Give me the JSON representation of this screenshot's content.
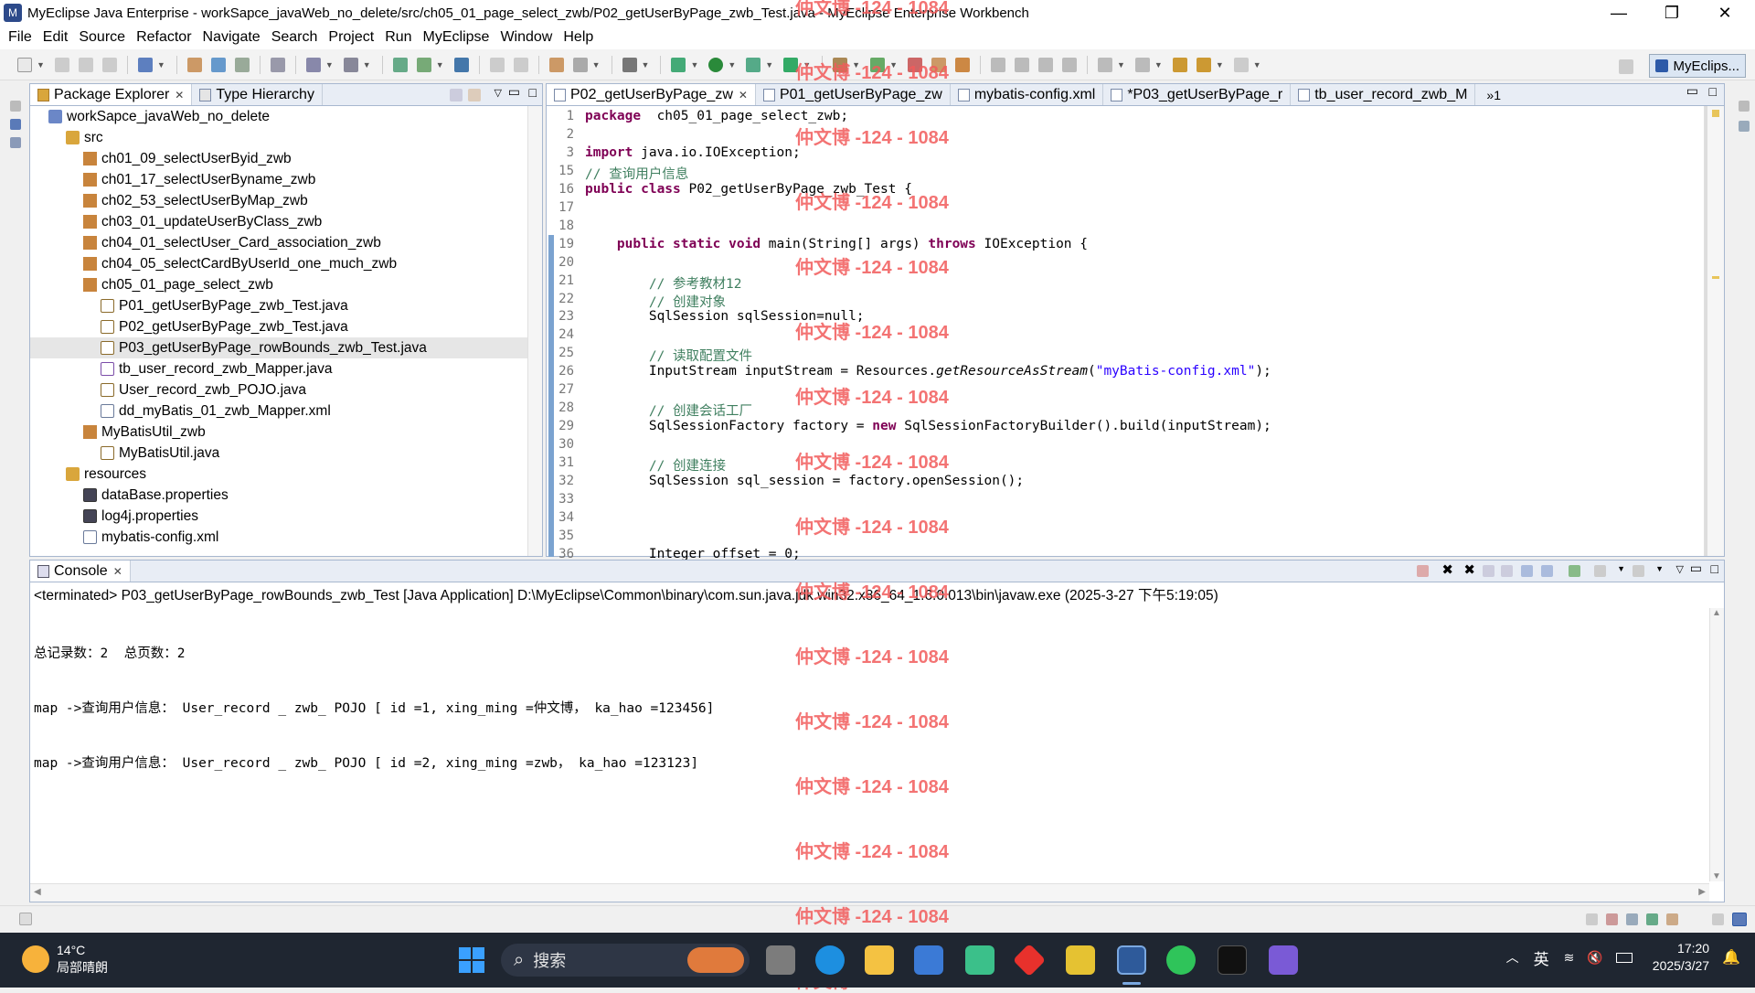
{
  "window": {
    "title": "MyEclipse Java Enterprise - workSapce_javaWeb_no_delete/src/ch05_01_page_select_zwb/P02_getUserByPage_zwb_Test.java - MyEclipse Enterprise Workbench"
  },
  "menu": [
    "File",
    "Edit",
    "Source",
    "Refactor",
    "Navigate",
    "Search",
    "Project",
    "Run",
    "MyEclipse",
    "Window",
    "Help"
  ],
  "perspective": {
    "label": "MyEclips..."
  },
  "package_explorer": {
    "tabs": [
      "Package Explorer",
      "Type Hierarchy"
    ],
    "tree": [
      {
        "label": "workSapce_javaWeb_no_delete",
        "type": "project",
        "indent": 0
      },
      {
        "label": "src",
        "type": "folder",
        "indent": 1
      },
      {
        "label": "ch01_09_selectUserByid_zwb",
        "type": "pkg",
        "indent": 2
      },
      {
        "label": "ch01_17_selectUserByname_zwb",
        "type": "pkg",
        "indent": 2
      },
      {
        "label": "ch02_53_selectUserByMap_zwb",
        "type": "pkg",
        "indent": 2
      },
      {
        "label": "ch03_01_updateUserByClass_zwb",
        "type": "pkg",
        "indent": 2
      },
      {
        "label": "ch04_01_selectUser_Card_association_zwb",
        "type": "pkg",
        "indent": 2
      },
      {
        "label": "ch04_05_selectCardByUserId_one_much_zwb",
        "type": "pkg",
        "indent": 2
      },
      {
        "label": "ch05_01_page_select_zwb",
        "type": "pkg",
        "indent": 2
      },
      {
        "label": "P01_getUserByPage_zwb_Test.java",
        "type": "java",
        "indent": 3
      },
      {
        "label": "P02_getUserByPage_zwb_Test.java",
        "type": "java",
        "indent": 3
      },
      {
        "label": "P03_getUserByPage_rowBounds_zwb_Test.java",
        "type": "java",
        "indent": 3,
        "selected": true
      },
      {
        "label": "tb_user_record_zwb_Mapper.java",
        "type": "interface",
        "indent": 3
      },
      {
        "label": "User_record_zwb_POJO.java",
        "type": "java",
        "indent": 3
      },
      {
        "label": "dd_myBatis_01_zwb_Mapper.xml",
        "type": "xml",
        "indent": 3
      },
      {
        "label": "MyBatisUtil_zwb",
        "type": "pkg",
        "indent": 2
      },
      {
        "label": "MyBatisUtil.java",
        "type": "java",
        "indent": 3
      },
      {
        "label": "resources",
        "type": "folder",
        "indent": 1
      },
      {
        "label": "dataBase.properties",
        "type": "props",
        "indent": 2
      },
      {
        "label": "log4j.properties",
        "type": "props",
        "indent": 2
      },
      {
        "label": "mybatis-config.xml",
        "type": "xml",
        "indent": 2
      }
    ]
  },
  "editor": {
    "tabs": [
      {
        "label": "P02_getUserByPage_zw",
        "active": true
      },
      {
        "label": "P01_getUserByPage_zw",
        "active": false
      },
      {
        "label": "mybatis-config.xml",
        "active": false
      },
      {
        "label": "*P03_getUserByPage_r",
        "active": false
      },
      {
        "label": "tb_user_record_zwb_M",
        "active": false
      }
    ],
    "overflow": "»1",
    "lines": [
      {
        "n": "1",
        "segs": [
          [
            "kw",
            "package"
          ],
          [
            "",
            "  ch05_01_page_select_zwb;"
          ]
        ]
      },
      {
        "n": "2",
        "segs": []
      },
      {
        "n": "3",
        "segs": [
          [
            "kw",
            "import"
          ],
          [
            "",
            " java.io.IOException;"
          ]
        ]
      },
      {
        "n": "15",
        "segs": [
          [
            "cm",
            "// 查询用户信息"
          ]
        ]
      },
      {
        "n": "16",
        "segs": [
          [
            "kw",
            "public class"
          ],
          [
            "",
            " P02_getUserByPage_zwb_Test {"
          ]
        ]
      },
      {
        "n": "17",
        "segs": []
      },
      {
        "n": "18",
        "segs": []
      },
      {
        "n": "19",
        "segs": [
          [
            "",
            "    "
          ],
          [
            "kw",
            "public static void"
          ],
          [
            "",
            " main(String[] args) "
          ],
          [
            "kw",
            "throws"
          ],
          [
            "",
            " IOException {"
          ]
        ]
      },
      {
        "n": "20",
        "segs": []
      },
      {
        "n": "21",
        "segs": [
          [
            "cm",
            "        // 参考教材12"
          ]
        ]
      },
      {
        "n": "22",
        "segs": [
          [
            "cm",
            "        // 创建对象"
          ]
        ]
      },
      {
        "n": "23",
        "segs": [
          [
            "",
            "        SqlSession sqlSession=null;"
          ]
        ]
      },
      {
        "n": "24",
        "segs": []
      },
      {
        "n": "25",
        "segs": [
          [
            "cm",
            "        // 读取配置文件"
          ]
        ]
      },
      {
        "n": "26",
        "segs": [
          [
            "",
            "        InputStream inputStream = Resources."
          ],
          [
            "it",
            "getResourceAsStream"
          ],
          [
            "",
            "("
          ],
          [
            "st",
            "\"myBatis-config.xml\""
          ],
          [
            "",
            ");"
          ]
        ]
      },
      {
        "n": "27",
        "segs": []
      },
      {
        "n": "28",
        "segs": [
          [
            "cm",
            "        // 创建会话工厂"
          ]
        ]
      },
      {
        "n": "29",
        "segs": [
          [
            "",
            "        SqlSessionFactory factory = "
          ],
          [
            "kw",
            "new"
          ],
          [
            "",
            " SqlSessionFactoryBuilder().build(inputStream);"
          ]
        ]
      },
      {
        "n": "30",
        "segs": []
      },
      {
        "n": "31",
        "segs": [
          [
            "cm",
            "        // 创建连接"
          ]
        ]
      },
      {
        "n": "32",
        "segs": [
          [
            "",
            "        SqlSession sql_session = factory.openSession();"
          ]
        ]
      },
      {
        "n": "33",
        "segs": []
      },
      {
        "n": "34",
        "segs": []
      },
      {
        "n": "35",
        "segs": []
      },
      {
        "n": "36",
        "segs": [
          [
            "",
            "        Integer offset = 0;"
          ]
        ]
      }
    ]
  },
  "console": {
    "tab": "Console",
    "header": "<terminated> P03_getUserByPage_rowBounds_zwb_Test [Java Application] D:\\MyEclipse\\Common\\binary\\com.sun.java.jdk.win32.x86_64_1.6.0.013\\bin\\javaw.exe (2025-3-27 下午5:19:05)",
    "lines": [
      "总记录数：2  总页数：2",
      "map ->查询用户信息： User_record _ zwb_ POJO [ id =1, xing_ming =仲文博， ka_hao =123456]",
      "map ->查询用户信息： User_record _ zwb_ POJO [ id =2, xing_ming =zwb， ka_hao =123123]"
    ]
  },
  "watermark": "仲文博 -124 - 1084",
  "taskbar": {
    "weather_temp": "14°C",
    "weather_desc": "局部晴朗",
    "search_placeholder": "搜索",
    "ime": "英",
    "time": "17:20",
    "date": "2025/3/27"
  },
  "colors": {
    "accent": "#2d5aa8",
    "keyword": "#7f0055",
    "comment": "#3f7f5f",
    "string": "#2a00ff",
    "watermark": "#f25b5b"
  }
}
